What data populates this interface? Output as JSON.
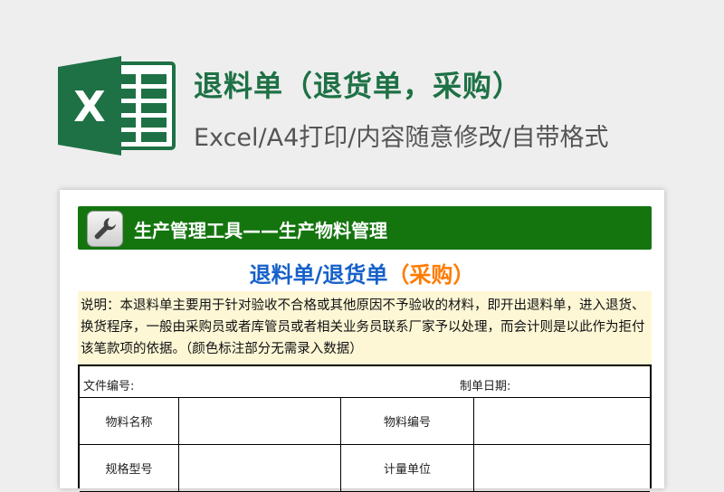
{
  "header": {
    "title": "退料单（退货单，采购）",
    "subtitle": "Excel/A4打印/内容随意修改/自带格式",
    "logo_letter": "X",
    "logo_icon": "excel-logo-icon"
  },
  "sheet": {
    "toolbar_text": "生产管理工具——生产物料管理",
    "toolbar_icon": "wrench-icon",
    "doc_title_main": "退料单/退货单",
    "doc_title_sub": "（采购）",
    "note": "说明：本退料单主要用于针对验收不合格或其他原因不予验收的材料，即开出退料单，进入退货、换货程序，一般由采购员或者库管员或者相关业务员联系厂家予以处理，而会计则是以此作为拒付该笔款项的依据。（颜色标注部分无需录入数据）",
    "form": {
      "doc_no_label": "文件编号:",
      "date_label": "制单日期:",
      "rows": [
        {
          "label1": "物料名称",
          "value1": "",
          "label2": "物料编号",
          "value2": ""
        },
        {
          "label1": "规格型号",
          "value1": "",
          "label2": "计量单位",
          "value2": ""
        }
      ]
    }
  },
  "colors": {
    "brand_green": "#1e7145",
    "toolbar_green": "#14750f",
    "title_blue": "#1661c9",
    "title_orange": "#ff7b00",
    "note_bg": "#fdf7d6"
  }
}
